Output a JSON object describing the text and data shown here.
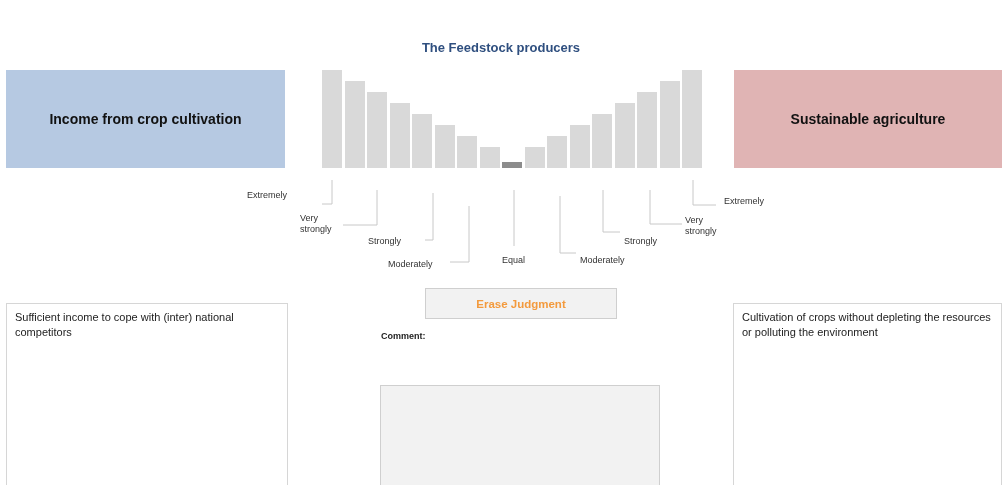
{
  "title": "The Feedstock producers",
  "left": {
    "criterion": "Income from crop cultivation",
    "description": "Sufficient income to cope with (inter) national competitors"
  },
  "right": {
    "criterion": "Sustainable agriculture",
    "description": "Cultivation of crops without depleting the resources or polluting the environment"
  },
  "scale": [
    {
      "label": "Extremely",
      "selected": false
    },
    {
      "selected": false
    },
    {
      "label": "Very strongly",
      "selected": false
    },
    {
      "selected": false
    },
    {
      "label": "Strongly",
      "selected": false
    },
    {
      "selected": false
    },
    {
      "label": "Moderately",
      "selected": false
    },
    {
      "selected": false
    },
    {
      "label": "Equal",
      "selected": true
    },
    {
      "selected": false
    },
    {
      "label": "Moderately",
      "selected": false
    },
    {
      "selected": false
    },
    {
      "label": "Strongly",
      "selected": false
    },
    {
      "selected": false
    },
    {
      "label": "Very strongly",
      "selected": false
    },
    {
      "selected": false
    },
    {
      "label": "Extremely",
      "selected": false
    }
  ],
  "erase_button": "Erase Judgment",
  "comment": {
    "label": "Comment:"
  }
}
